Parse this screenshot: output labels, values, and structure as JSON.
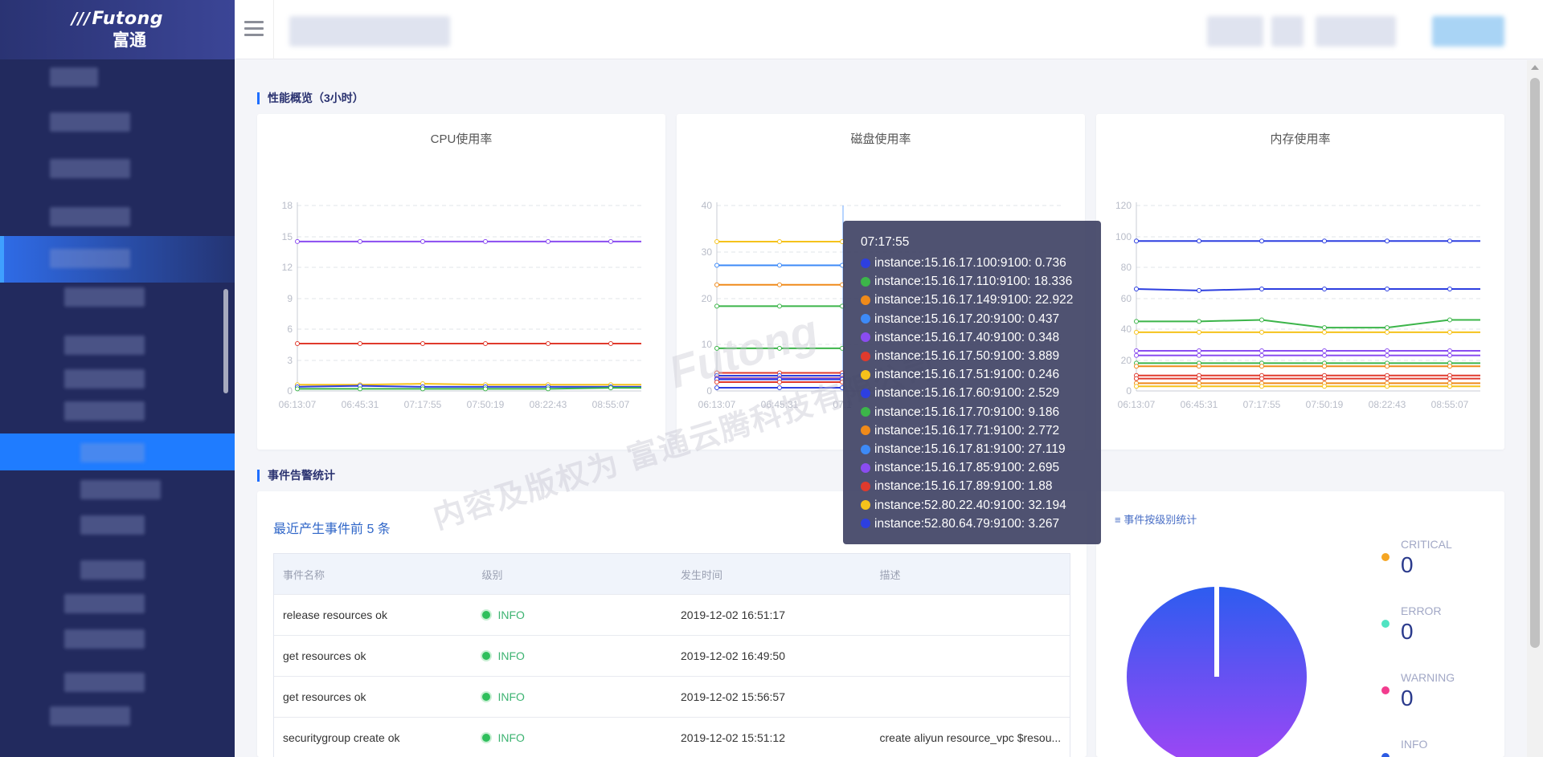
{
  "app": {
    "logo_text": "Futong",
    "logo_sub": "富通"
  },
  "overview": {
    "section_title": "性能概览（3小时）",
    "cpu": {
      "title": "CPU使用率",
      "y_ticks": [
        "0",
        "3",
        "6",
        "9",
        "12",
        "15",
        "18"
      ],
      "x_ticks": [
        "06:13:07",
        "06:45:31",
        "07:17:55",
        "07:50:19",
        "08:22:43",
        "08:55:07"
      ]
    },
    "disk": {
      "title": "磁盘使用率",
      "y_ticks": [
        "0",
        "10",
        "20",
        "30",
        "40"
      ],
      "x_ticks": [
        "06:13:07",
        "06:45:31",
        "07:1"
      ]
    },
    "memory": {
      "title": "内存使用率",
      "y_ticks": [
        "0",
        "20",
        "40",
        "60",
        "80",
        "100",
        "120"
      ],
      "x_ticks": [
        "06:13:07",
        "06:45:31",
        "07:17:55",
        "07:50:19",
        "08:22:43",
        "08:55:07"
      ]
    }
  },
  "tooltip": {
    "time": "07:17:55",
    "rows": [
      {
        "label": "instance:15.16.17.100:9100: 0.736",
        "color": "#2d3fe0"
      },
      {
        "label": "instance:15.16.17.110:9100: 18.336",
        "color": "#3cb54a"
      },
      {
        "label": "instance:15.16.17.149:9100: 22.922",
        "color": "#ef8a1a"
      },
      {
        "label": "instance:15.16.17.20:9100: 0.437",
        "color": "#3d8af7"
      },
      {
        "label": "instance:15.16.17.40:9100: 0.348",
        "color": "#8a4cf0"
      },
      {
        "label": "instance:15.16.17.50:9100: 3.889",
        "color": "#e03a2d"
      },
      {
        "label": "instance:15.16.17.51:9100: 0.246",
        "color": "#f5c21b"
      },
      {
        "label": "instance:15.16.17.60:9100: 2.529",
        "color": "#2d3fe0"
      },
      {
        "label": "instance:15.16.17.70:9100: 9.186",
        "color": "#3cb54a"
      },
      {
        "label": "instance:15.16.17.71:9100: 2.772",
        "color": "#ef8a1a"
      },
      {
        "label": "instance:15.16.17.81:9100: 27.119",
        "color": "#3d8af7"
      },
      {
        "label": "instance:15.16.17.85:9100: 2.695",
        "color": "#8a4cf0"
      },
      {
        "label": "instance:15.16.17.89:9100: 1.88",
        "color": "#e03a2d"
      },
      {
        "label": "instance:52.80.22.40:9100: 32.194",
        "color": "#f5c21b"
      },
      {
        "label": "instance:52.80.64.79:9100: 3.267",
        "color": "#2d3fe0"
      }
    ]
  },
  "watermark": {
    "text": "内容及版权为 富通云腾科技有限公司",
    "brand": "Futong"
  },
  "events": {
    "section_title": "事件告警统计",
    "recent_title": "最近产生事件前 5 条",
    "columns": [
      "事件名称",
      "级别",
      "发生时间",
      "描述"
    ],
    "rows": [
      {
        "name": "release resources ok",
        "level": "INFO",
        "time": "2019-12-02 16:51:17",
        "desc": ""
      },
      {
        "name": "get resources ok",
        "level": "INFO",
        "time": "2019-12-02 16:49:50",
        "desc": ""
      },
      {
        "name": "get resources ok",
        "level": "INFO",
        "time": "2019-12-02 15:56:57",
        "desc": ""
      },
      {
        "name": "securitygroup create ok",
        "level": "INFO",
        "time": "2019-12-02 15:51:12",
        "desc": "create aliyun resource_vpc $resou..."
      }
    ]
  },
  "level_stats": {
    "title": "≡ 事件按级别统计",
    "items": [
      {
        "name": "CRITICAL",
        "value": "0",
        "color": "#f5a623"
      },
      {
        "name": "ERROR",
        "value": "0",
        "color": "#50e3c2"
      },
      {
        "name": "WARNING",
        "value": "0",
        "color": "#f23c8e"
      },
      {
        "name": "INFO",
        "value": "",
        "color": "#2d5be3"
      }
    ]
  },
  "chart_data": [
    {
      "type": "line",
      "title": "CPU使用率",
      "x": [
        "06:13:07",
        "06:45:31",
        "07:17:55",
        "07:50:19",
        "08:22:43",
        "08:55:07"
      ],
      "ylim": [
        0,
        18
      ],
      "series": [
        {
          "values": [
            14.5,
            14.5,
            14.5,
            14.5,
            14.5,
            14.5
          ],
          "color": "#8a4cf0"
        },
        {
          "values": [
            4.6,
            4.6,
            4.6,
            4.6,
            4.6,
            4.6
          ],
          "color": "#e03a2d"
        },
        {
          "values": [
            0.6,
            0.6,
            0.7,
            0.6,
            0.6,
            0.6
          ],
          "color": "#f5c21b"
        },
        {
          "values": [
            0.4,
            0.5,
            0.4,
            0.4,
            0.4,
            0.4
          ],
          "color": "#2d3fe0"
        },
        {
          "values": [
            0.2,
            0.2,
            0.2,
            0.2,
            0.2,
            0.3
          ],
          "color": "#3cb54a"
        }
      ]
    },
    {
      "type": "line",
      "title": "磁盘使用率",
      "x": [
        "06:13:07",
        "06:45:31",
        "07:17:55",
        "07:50:19",
        "08:22:43",
        "08:55:07"
      ],
      "ylim": [
        0,
        40
      ],
      "series": [
        {
          "values": [
            32.2,
            32.2,
            32.2
          ],
          "color": "#f5c21b"
        },
        {
          "values": [
            27.1,
            27.1,
            27.1
          ],
          "color": "#3d8af7"
        },
        {
          "values": [
            22.9,
            22.9,
            22.9
          ],
          "color": "#ef8a1a"
        },
        {
          "values": [
            18.3,
            18.3,
            18.3
          ],
          "color": "#3cb54a"
        },
        {
          "values": [
            9.2,
            9.2,
            9.2
          ],
          "color": "#3cb54a"
        },
        {
          "values": [
            3.9,
            3.9,
            3.9
          ],
          "color": "#e03a2d"
        },
        {
          "values": [
            3.3,
            3.3,
            3.3
          ],
          "color": "#2d3fe0"
        },
        {
          "values": [
            2.8,
            2.8,
            2.8
          ],
          "color": "#ef8a1a"
        },
        {
          "values": [
            2.7,
            2.7,
            2.7
          ],
          "color": "#8a4cf0"
        },
        {
          "values": [
            2.5,
            2.5,
            2.5
          ],
          "color": "#2d3fe0"
        },
        {
          "values": [
            1.9,
            1.9,
            1.9
          ],
          "color": "#e03a2d"
        },
        {
          "values": [
            0.7,
            0.7,
            0.7
          ],
          "color": "#2d3fe0"
        }
      ]
    },
    {
      "type": "line",
      "title": "内存使用率",
      "x": [
        "06:13:07",
        "06:45:31",
        "07:17:55",
        "07:50:19",
        "08:22:43",
        "08:55:07"
      ],
      "ylim": [
        0,
        120
      ],
      "series": [
        {
          "values": [
            97,
            97,
            97,
            97,
            97,
            97
          ],
          "color": "#2d3fe0"
        },
        {
          "values": [
            66,
            65,
            66,
            66,
            66,
            66
          ],
          "color": "#2d3fe0"
        },
        {
          "values": [
            45,
            45,
            46,
            41,
            41,
            46
          ],
          "color": "#3cb54a"
        },
        {
          "values": [
            38,
            38,
            38,
            38,
            38,
            38
          ],
          "color": "#f5c21b"
        },
        {
          "values": [
            26,
            26,
            26,
            26,
            26,
            26
          ],
          "color": "#8a4cf0"
        },
        {
          "values": [
            23,
            23,
            23,
            23,
            23,
            23
          ],
          "color": "#8a4cf0"
        },
        {
          "values": [
            18,
            18,
            18,
            18,
            18,
            18
          ],
          "color": "#3cb54a"
        },
        {
          "values": [
            16,
            16,
            16,
            16,
            16,
            16
          ],
          "color": "#ef8a1a"
        },
        {
          "values": [
            10,
            10,
            10,
            10,
            10,
            10
          ],
          "color": "#e03a2d"
        },
        {
          "values": [
            8,
            8,
            8,
            8,
            8,
            8
          ],
          "color": "#e03a2d"
        },
        {
          "values": [
            5,
            5,
            5,
            5,
            5,
            5
          ],
          "color": "#ef8a1a"
        },
        {
          "values": [
            3,
            3,
            3,
            3,
            3,
            3
          ],
          "color": "#f5c21b"
        }
      ]
    },
    {
      "type": "pie",
      "labels": [
        "CRITICAL",
        "ERROR",
        "WARNING",
        "INFO"
      ],
      "values": [
        0,
        0,
        0,
        1
      ]
    }
  ]
}
